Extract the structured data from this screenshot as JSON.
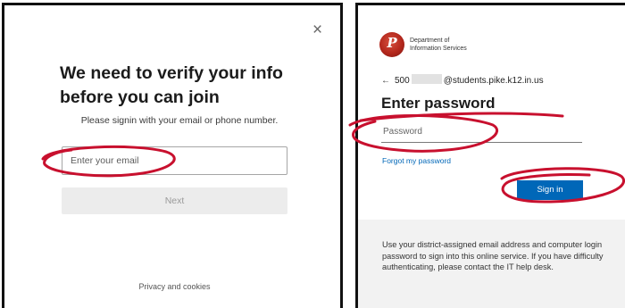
{
  "left_panel": {
    "title": "We need to verify your info before you can join",
    "subtitle": "Please signin with your email or phone number.",
    "email_placeholder": "Enter your email",
    "next_label": "Next",
    "privacy_label": "Privacy and cookies",
    "close_icon": "×"
  },
  "right_panel": {
    "org_name": "Department of\nInformation Services",
    "logo_letter": "P",
    "back_arrow": "←",
    "account_prefix": "500",
    "account_suffix": "@students.pike.k12.in.us",
    "title": "Enter password",
    "password_placeholder": "Password",
    "forgot_label": "Forgot my password",
    "signin_label": "Sign in",
    "help_text": "Use your district-assigned email address and computer login password to sign into this online service. If you have difficulty authenticating, please contact the IT help desk."
  },
  "colors": {
    "accent_blue": "#0067b8",
    "marker_red": "#c8102e",
    "logo_red": "#b3271c"
  },
  "icons": [
    "close-icon",
    "back-arrow-icon",
    "district-logo-icon"
  ]
}
